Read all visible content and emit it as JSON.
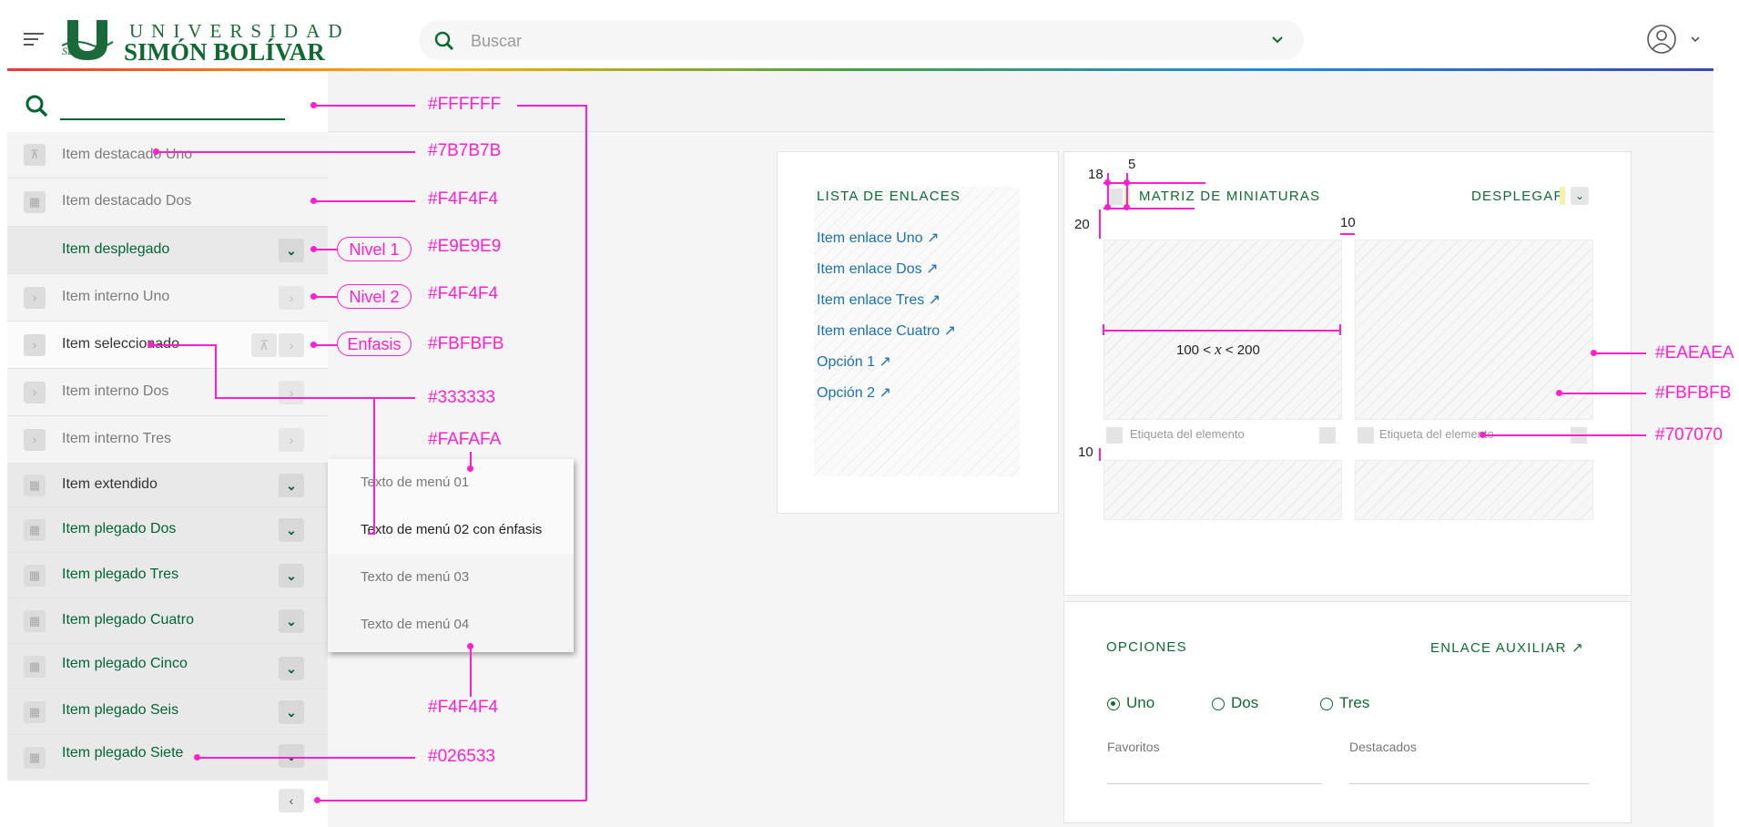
{
  "header": {
    "logo_top": "UNIVERSIDAD",
    "logo_bottom": "SIMÓN BOLÍVAR",
    "search_placeholder": "Buscar"
  },
  "sidebar": {
    "items": [
      {
        "label": "Item destacado Uno"
      },
      {
        "label": "Item destacado Dos"
      },
      {
        "label": "Item desplegado"
      },
      {
        "label": "Item interno Uno"
      },
      {
        "label": "Item seleccionado"
      },
      {
        "label": "Item interno Dos"
      },
      {
        "label": "Item interno Tres"
      },
      {
        "label": "Item extendido"
      },
      {
        "label": "Item plegado Dos"
      },
      {
        "label": "Item plegado Tres"
      },
      {
        "label": "Item plegado Cuatro"
      },
      {
        "label": "Item plegado Cinco"
      },
      {
        "label": "Item plegado Seis"
      },
      {
        "label": "Item plegado Siete"
      }
    ]
  },
  "menu": {
    "items": [
      {
        "label": "Texto de menú 01"
      },
      {
        "label": "Texto de menú 02 con énfasis"
      },
      {
        "label": "Texto de menú 03"
      },
      {
        "label": "Texto de menú 04"
      }
    ]
  },
  "annotations": {
    "c_ffffff": "#FFFFFF",
    "c_7b7b7b": "#7B7B7B",
    "c_f4f4f4_a": "#F4F4F4",
    "c_e9e9e9": "#E9E9E9",
    "c_f4f4f4_b": "#F4F4F4",
    "c_fbfbfb_a": "#FBFBFB",
    "c_333333": "#333333",
    "c_fafafa": "#FAFAFA",
    "c_f4f4f4_c": "#F4F4F4",
    "c_026533": "#026533",
    "c_eaeaea": "#EAEAEA",
    "c_fbfbfb_b": "#FBFBFB",
    "c_707070": "#707070",
    "nivel1": "Nivel 1",
    "nivel2": "Nivel 2",
    "enfasis": "Enfasis",
    "dim_18": "18",
    "dim_5": "5",
    "dim_20": "20",
    "dim_10a": "10",
    "dim_10b": "10",
    "range_left": "100 <",
    "range_x": "x",
    "range_right": "< 200"
  },
  "links_card": {
    "title": "LISTA DE ENLACES",
    "links": [
      {
        "label": "Item enlace Uno"
      },
      {
        "label": "Item enlace Dos"
      },
      {
        "label": "Item enlace Tres"
      },
      {
        "label": "Item enlace Cuatro"
      },
      {
        "label": "Opción 1"
      },
      {
        "label": "Opción 2"
      }
    ]
  },
  "thumbs_card": {
    "title": "MATRIZ DE MINIATURAS",
    "action": "DESPLEGAR",
    "item_label_1": "Etiqueta del elemento",
    "item_label_2": "Etiqueta del elemento"
  },
  "options_card": {
    "title": "OPCIONES",
    "aux_link": "ENLACE AUXILIAR",
    "radios": [
      {
        "label": "Uno",
        "checked": true
      },
      {
        "label": "Dos",
        "checked": false
      },
      {
        "label": "Tres",
        "checked": false
      }
    ],
    "field1_label": "Favoritos",
    "field2_label": "Destacados"
  },
  "colors": {
    "brand_green": "#026533",
    "link_blue": "#1b72b3",
    "annotation_magenta": "#ff1fcf"
  }
}
